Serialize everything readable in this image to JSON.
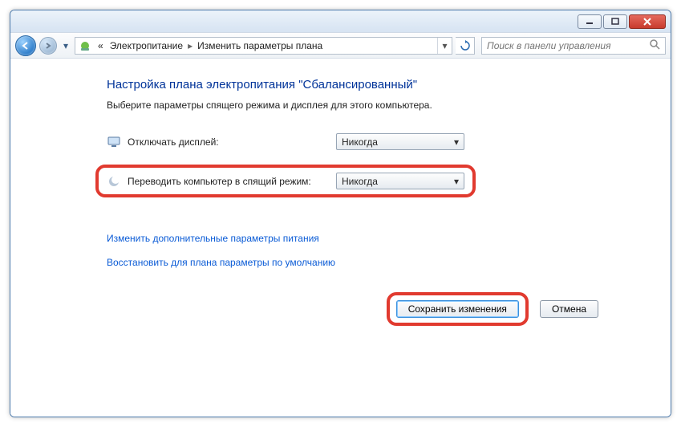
{
  "titlebar": {},
  "nav": {
    "breadcrumb_prefix": "«",
    "breadcrumb1": "Электропитание",
    "breadcrumb2": "Изменить параметры плана"
  },
  "search": {
    "placeholder": "Поиск в панели управления"
  },
  "page": {
    "heading": "Настройка плана электропитания \"Сбалансированный\"",
    "subtext": "Выберите параметры спящего режима и дисплея для этого компьютера."
  },
  "settings": {
    "display_off": {
      "label": "Отключать дисплей:",
      "value": "Никогда"
    },
    "sleep": {
      "label": "Переводить компьютер в спящий режим:",
      "value": "Никогда"
    }
  },
  "links": {
    "advanced": "Изменить дополнительные параметры питания",
    "restore": "Восстановить для плана параметры по умолчанию"
  },
  "buttons": {
    "save": "Сохранить изменения",
    "cancel": "Отмена"
  }
}
